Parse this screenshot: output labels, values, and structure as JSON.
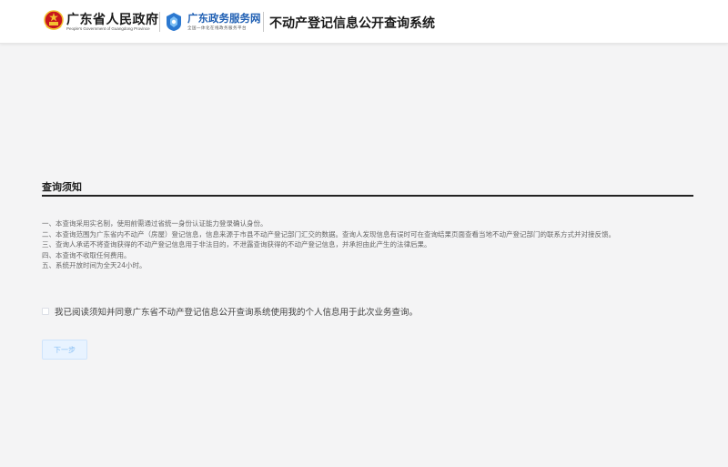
{
  "header": {
    "gov_name": "广东省人民政府",
    "gov_sub": "People's Government of Guangdong Province",
    "portal_name": "广东政务服务网",
    "portal_sub": "全国一体化在线政务服务平台",
    "system_title": "不动产登记信息公开查询系统"
  },
  "notice": {
    "title": "查询须知",
    "items": [
      "一、本查询采用实名制，使用前需通过省统一身份认证能力登录确认身份。",
      "二、本查询范围为广东省内不动产（房屋）登记信息，信息来源于市县不动产登记部门汇交的数据。查询人发现信息有误时可在查询结果页面查看当地不动产登记部门的联系方式并对接反馈。",
      "三、查询人承诺不将查询获得的不动产登记信息用于非法目的，不泄露查询获得的不动产登记信息，并承担由此产生的法律后果。",
      "四、本查询不收取任何费用。",
      "五、系统开放时间为全天24小时。"
    ]
  },
  "agreement": {
    "checked": false,
    "label": "我已阅读须知并同意广东省不动产登记信息公开查询系统使用我的个人信息用于此次业务查询。"
  },
  "actions": {
    "next_label": "下一步"
  },
  "colors": {
    "portal_blue": "#1f5fb3",
    "emblem_red": "#c8161d",
    "emblem_gold": "#f2c230",
    "button_bg": "#e8f3ff",
    "button_text": "#8cc1f5"
  }
}
